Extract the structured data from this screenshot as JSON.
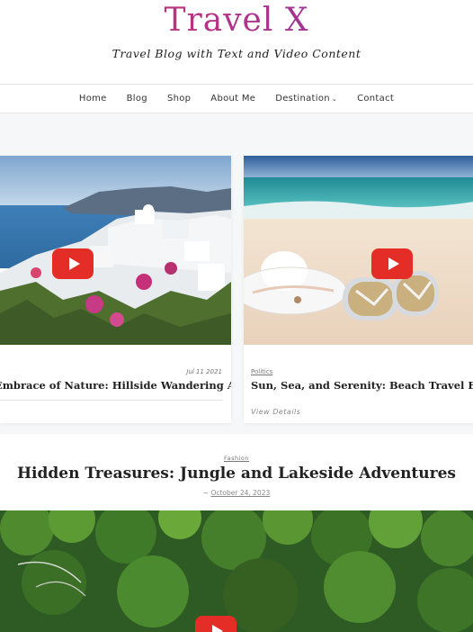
{
  "site": {
    "logo": "Travel X",
    "tagline": "Travel Blog with Text and Video Content"
  },
  "nav": {
    "items": [
      {
        "label": "Home"
      },
      {
        "label": "Blog"
      },
      {
        "label": "Shop"
      },
      {
        "label": "About Me"
      },
      {
        "label": "Destination"
      },
      {
        "label": "Contact"
      }
    ]
  },
  "slider": {
    "left_card": {
      "date": "Jul 11 2021",
      "title": "Embrace of Nature: Hillside Wandering Adventure"
    },
    "right_card": {
      "category": "Politics",
      "title": "Sun, Sea, and Serenity: Beach Travel Escapades",
      "view_details": "View Details"
    }
  },
  "featured": {
    "category": "Fashion",
    "title": "Hidden Treasures: Jungle and Lakeside Adventures",
    "date_prefix": "~",
    "date": "October 24, 2023"
  },
  "colors": {
    "logo_start": "#d6335f",
    "logo_end": "#7a3fb0",
    "play_red": "#e52d27"
  },
  "icons": {
    "play": "play-button-icon",
    "dropdown": "chevron-down-icon"
  }
}
